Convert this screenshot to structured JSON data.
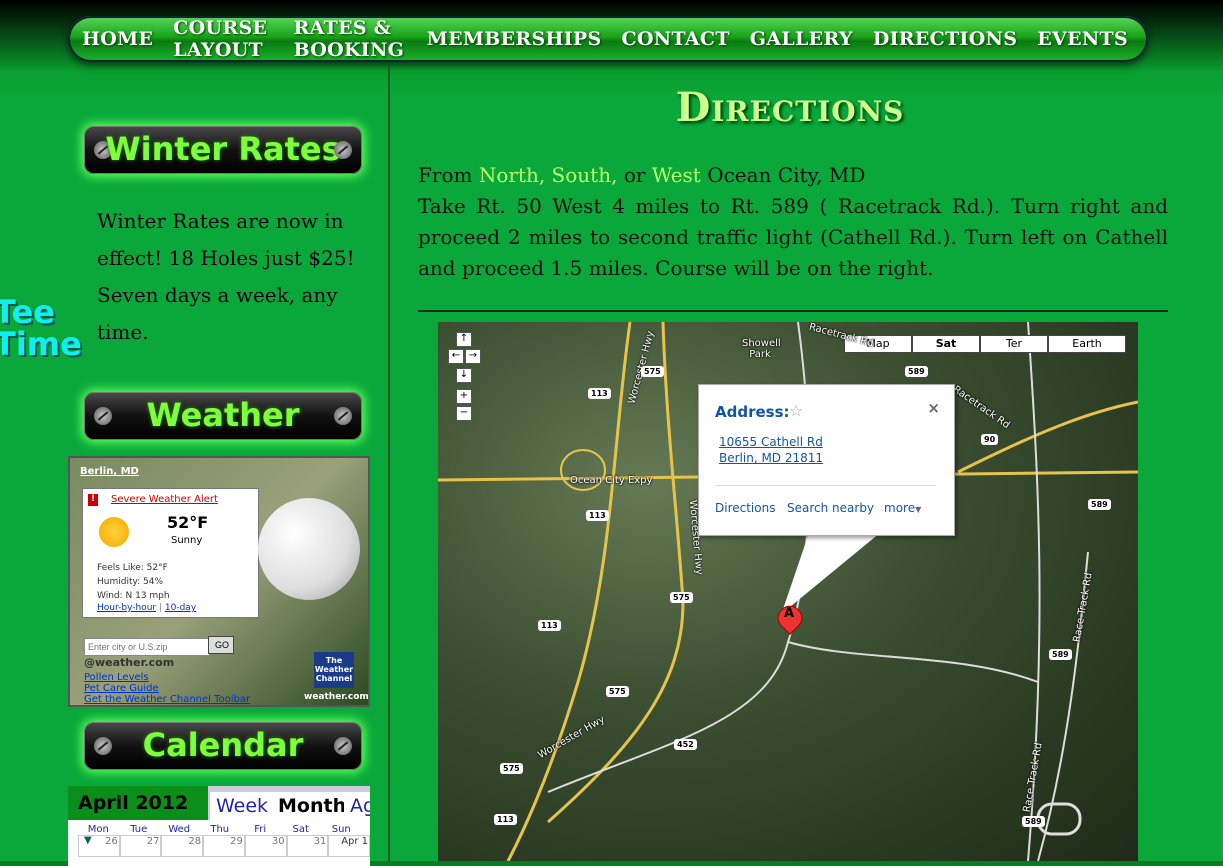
{
  "nav": {
    "items": [
      "HOME",
      "COURSE LAYOUT",
      "RATES & BOOKING",
      "MEMBERSHIPS",
      "CONTACT",
      "GALLERY",
      "DIRECTIONS",
      "EVENTS"
    ]
  },
  "sidebar": {
    "winter_rates_title": "Winter Rates",
    "winter_rates_text": "Winter Rates are now in effect! 18 Holes just $25! Seven days a week, any time.",
    "tee_time_line1": "Tee",
    "tee_time_line2": "Time",
    "weather_title": "Weather",
    "calendar_title": "Calendar"
  },
  "weather_widget": {
    "city": "Berlin, MD",
    "alert": "Severe Weather Alert",
    "temp": "52°F",
    "condition": "Sunny",
    "feels_like": "Feels Like: 52°F",
    "humidity": "Humidity: 54%",
    "wind": "Wind: N 13 mph",
    "hour_by_hour": "Hour-by-hour",
    "ten_day": "10-day",
    "search_placeholder": "Enter city or U.S.zip",
    "go_label": "GO",
    "brand": "@weather.com",
    "links": [
      "Pollen Levels",
      "Pet Care Guide",
      "Get the Weather Channel Toolbar"
    ],
    "logo_text": "The Weather Channel",
    "site": "weather.com"
  },
  "calendar": {
    "month": "April 2012",
    "tabs": [
      "Week",
      "Month",
      "Ag"
    ],
    "days": [
      "Mon",
      "Tue",
      "Wed",
      "Thu",
      "Fri",
      "Sat",
      "Sun"
    ],
    "dates": [
      "26",
      "27",
      "28",
      "29",
      "30",
      "31",
      "Apr 1"
    ]
  },
  "main": {
    "title": "Directions",
    "from_prefix": "From",
    "from_north_south": "North, South,",
    "from_or": "or",
    "from_west": "West",
    "from_suffix": "Ocean City, MD",
    "instructions": "Take Rt. 50 West 4 miles to Rt. 589 ( Racetrack Rd.). Turn right and proceed 2 miles to second traffic light (Cathell Rd.). Turn left on Cathell and proceed 1.5 miles. Course will be on the right."
  },
  "map": {
    "types": [
      "Map",
      "Sat",
      "Ter",
      "Earth"
    ],
    "selected_type": "Sat",
    "bubble_heading": "Address:",
    "address_line1": "10655 Cathell Rd",
    "address_line2": "Berlin, MD 21811",
    "bubble_links": [
      "Directions",
      "Search nearby",
      "more"
    ],
    "pin_label": "A",
    "labels": [
      "Showell Park",
      "Ocean City Expy",
      "Worcester Hwy",
      "Worcester Hwy",
      "Worcester Hwy",
      "Racetrack Rd",
      "Racetrack Rd",
      "Race Track Rd",
      "Race Track Rd"
    ],
    "shields": [
      "575",
      "113",
      "113",
      "575",
      "113",
      "575",
      "452",
      "575",
      "113",
      "589",
      "90",
      "589",
      "589",
      "589"
    ]
  }
}
